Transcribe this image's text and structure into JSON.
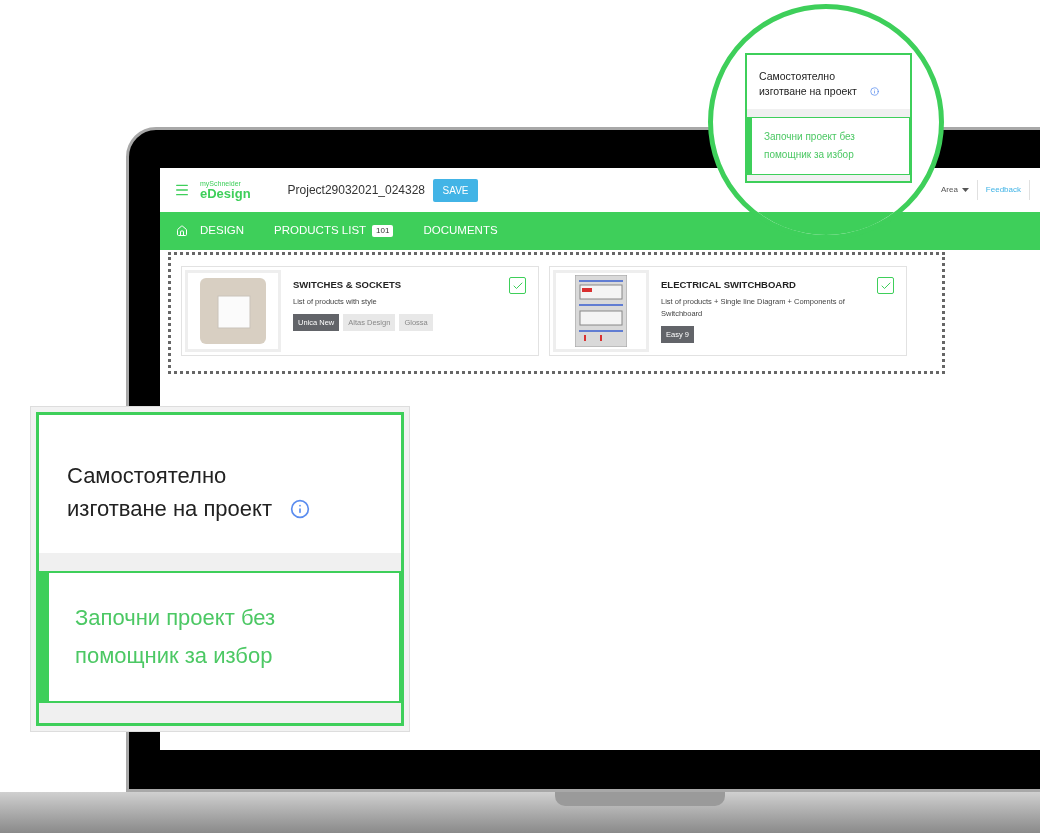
{
  "header": {
    "logo_top": "mySchneider",
    "logo": "eDesign",
    "project": "Project29032021_024328",
    "save": "SAVE",
    "area": "Area",
    "feedback": "Feedback"
  },
  "nav": [
    {
      "label": "DESIGN",
      "kind": "home"
    },
    {
      "label": "PRODUCTS LIST",
      "kind": "count",
      "badge": "101"
    },
    {
      "label": "DOCUMENTS",
      "kind": "plain"
    }
  ],
  "cards": [
    {
      "kind": "switch",
      "title": "SWITCHES & SOCKETS",
      "description": "List of products with style",
      "checked": true,
      "tags": [
        {
          "label": "Unica New",
          "selected": true
        },
        {
          "label": "Altas Design",
          "selected": false
        },
        {
          "label": "Glossa",
          "selected": false
        }
      ]
    },
    {
      "kind": "board",
      "title": "ELECTRICAL SWITCHBOARD",
      "description": "List of products + Single line Diagram + Components of Switchboard",
      "checked": true,
      "tags": [
        {
          "label": "Easy 9",
          "selected": true
        }
      ]
    }
  ],
  "magnifier": {
    "title": "Самостоятелно изготване на проект",
    "action": "Започни проект без помощник за избор"
  },
  "zoom_panel": {
    "title": "Самостоятелно изготване на проект",
    "action": "Започни проект без помощник за избор"
  }
}
